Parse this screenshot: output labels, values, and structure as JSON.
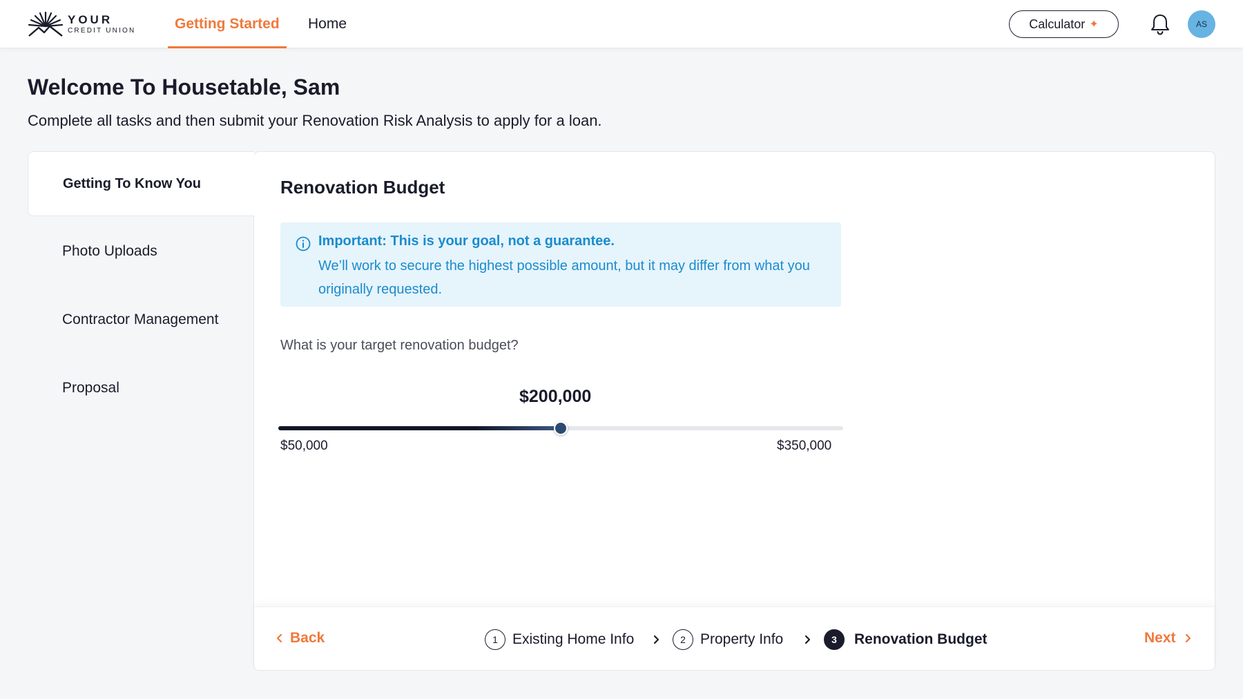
{
  "header": {
    "logo": {
      "line1": "YOUR",
      "line2": "CREDIT UNION"
    },
    "tabs": [
      {
        "label": "Getting Started",
        "active": true
      },
      {
        "label": "Home",
        "active": false
      }
    ],
    "calculator_label": "Calculator",
    "avatar_initials": "AS"
  },
  "page": {
    "title": "Welcome To Housetable, Sam",
    "subtitle": "Complete all tasks and then submit your Renovation Risk Analysis to apply for a loan."
  },
  "sidebar": {
    "items": [
      {
        "label": "Getting To Know You",
        "active": true
      },
      {
        "label": "Photo Uploads",
        "active": false
      },
      {
        "label": "Contractor Management",
        "active": false
      },
      {
        "label": "Proposal",
        "active": false
      }
    ]
  },
  "content": {
    "section_title": "Renovation Budget",
    "notice": {
      "title": "Important: This is your goal, not a guarantee.",
      "body": "We’ll work to secure the highest possible amount, but it may differ from what you originally requested."
    },
    "question": "What is your target renovation budget?",
    "slider": {
      "value_label": "$200,000",
      "value": 200000,
      "min": 50000,
      "max": 350000,
      "min_label": "$50,000",
      "max_label": "$350,000"
    }
  },
  "footer": {
    "back_label": "Back",
    "next_label": "Next",
    "steps": [
      {
        "number": "1",
        "label": "Existing Home Info",
        "current": false
      },
      {
        "number": "2",
        "label": "Property Info",
        "current": false
      },
      {
        "number": "3",
        "label": "Renovation Budget",
        "current": true
      }
    ]
  },
  "colors": {
    "accent": "#f0793b",
    "info_text": "#1a8ccd",
    "info_bg": "#e6f4fc",
    "dark": "#1a1c2b",
    "avatar": "#67b3e2"
  }
}
